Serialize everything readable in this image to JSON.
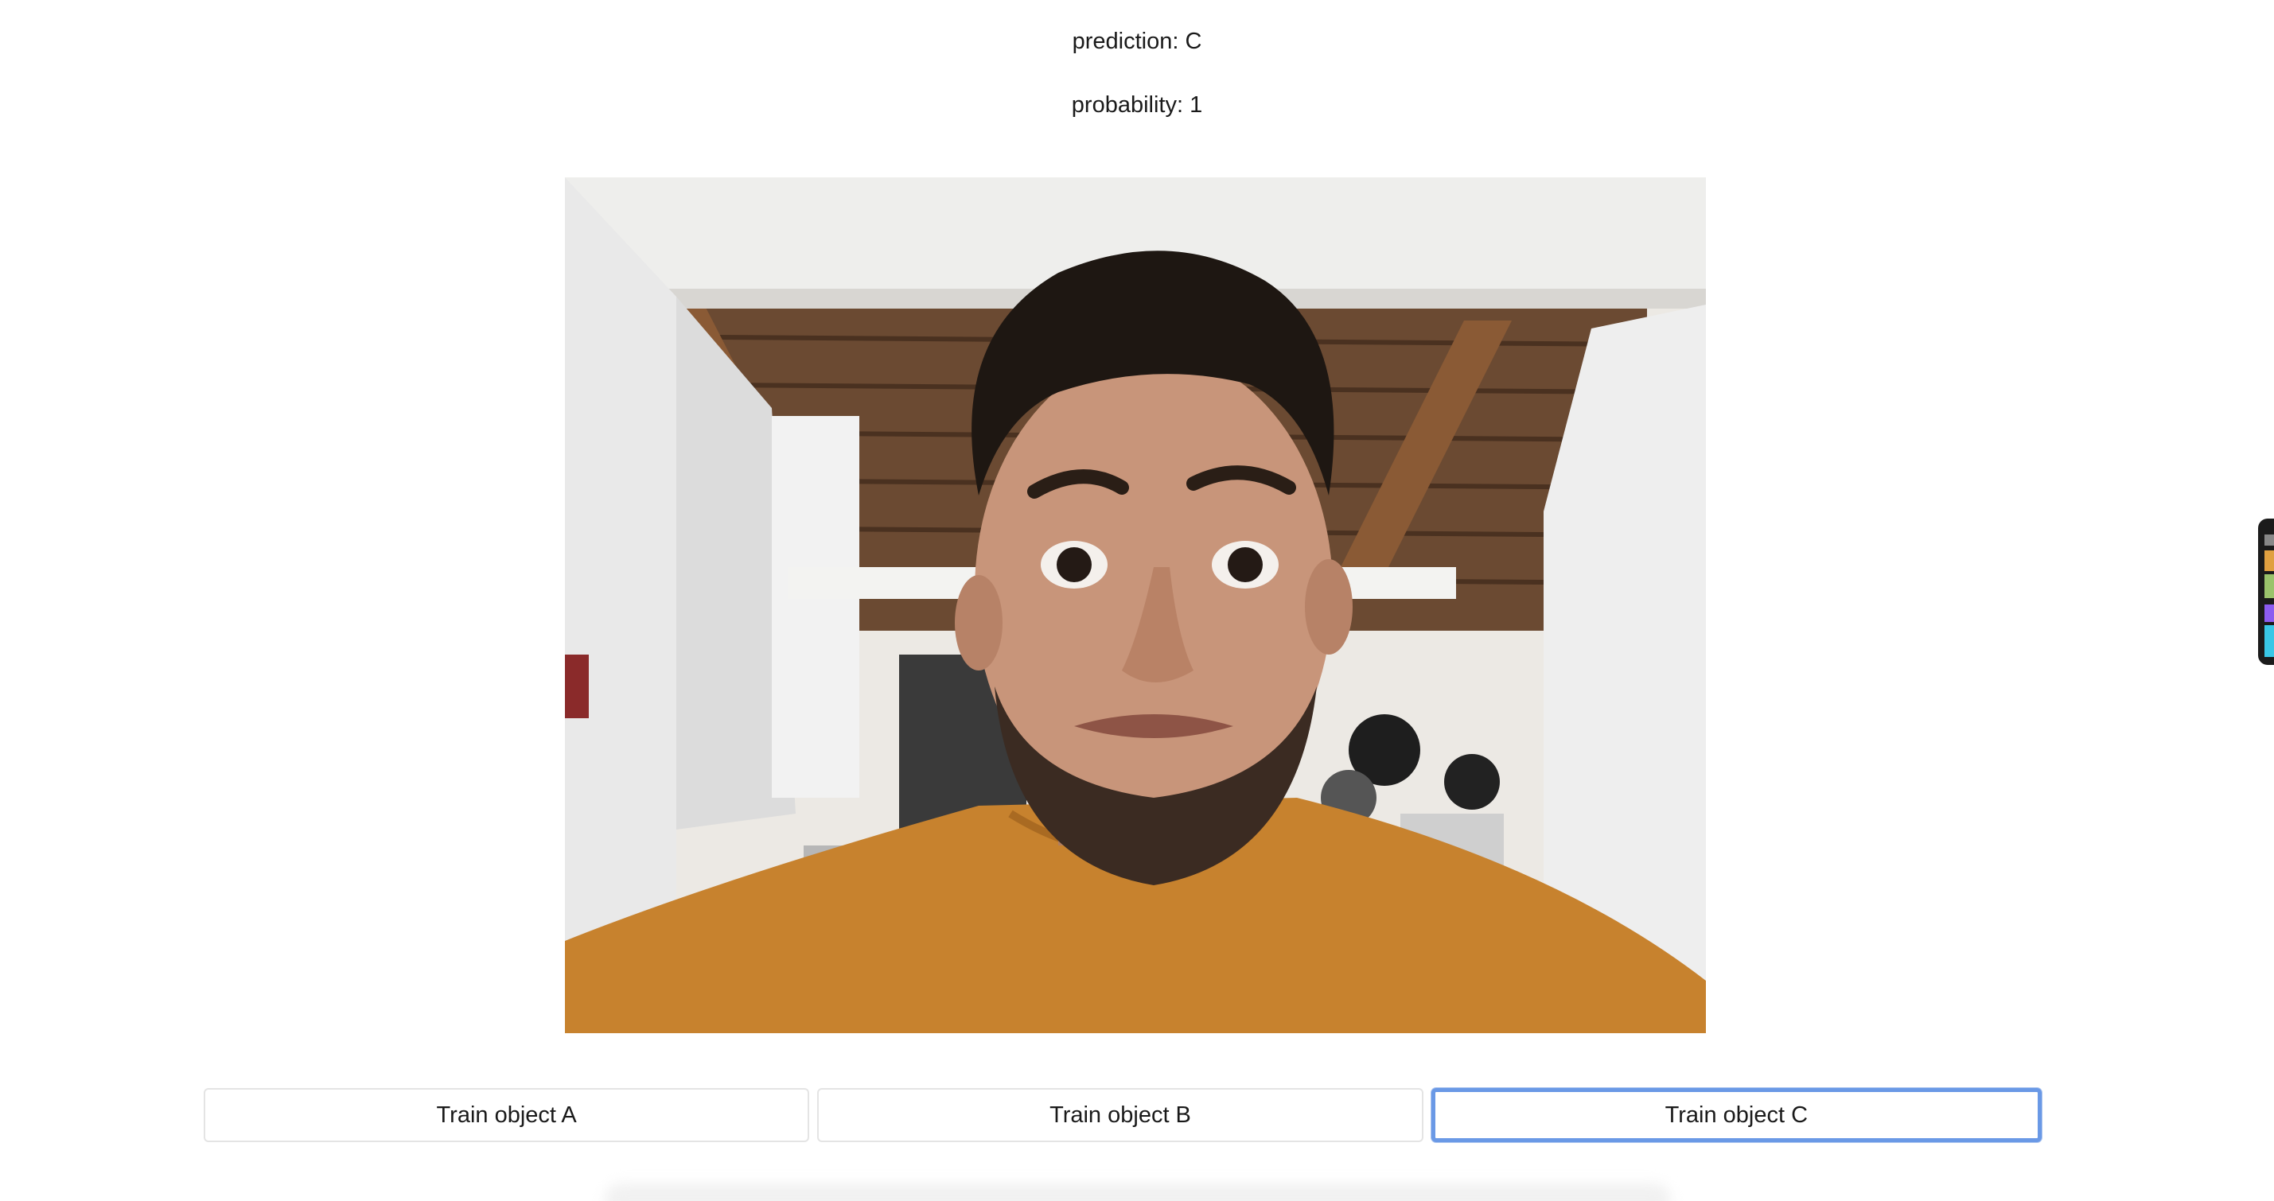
{
  "status": {
    "prediction_text": "prediction: C",
    "probability_text": "probability: 1"
  },
  "video": {
    "content": "webcam-feed"
  },
  "buttons": [
    {
      "label": "Train object A",
      "focused": false
    },
    {
      "label": "Train object B",
      "focused": false
    },
    {
      "label": "Train object C",
      "focused": true
    }
  ],
  "colors": {
    "focus_ring": "#6a99e6",
    "button_border": "#e4e4e4",
    "text": "#1a1a1a"
  }
}
